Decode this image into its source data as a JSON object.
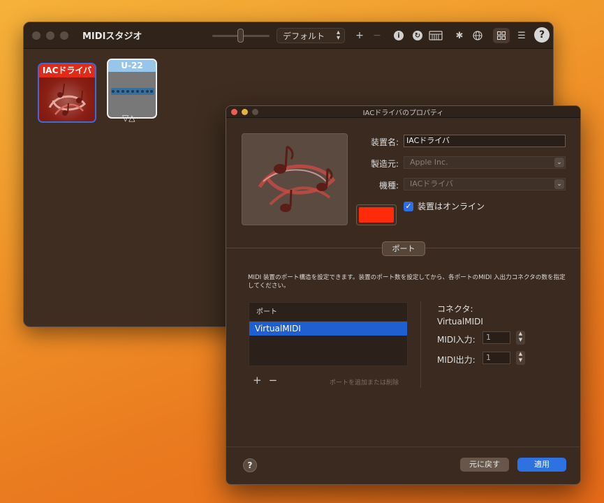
{
  "main_window": {
    "title": "MIDIスタジオ",
    "config_select": "デフォルト",
    "toolbar": {
      "add": "+",
      "remove": "−",
      "help": "?"
    },
    "devices": [
      {
        "label": "IACドライバ"
      },
      {
        "label": "U-22"
      }
    ]
  },
  "properties_window": {
    "title": "IACドライバのプロパティ",
    "fields": {
      "device_name_label": "装置名:",
      "device_name_value": "IACドライバ",
      "manufacturer_label": "製造元:",
      "manufacturer_value": "Apple Inc.",
      "model_label": "機種:",
      "model_value": "IACドライバ"
    },
    "online_checkbox": {
      "label": "装置はオンライン",
      "checked": true
    },
    "color": "#ff2a0a",
    "port_tab": "ポート",
    "description": "MIDI 装置のポート構造を設定できます。装置のポート数を設定してから、各ポートのMIDI 入出力コネクタの数を指定してください。",
    "port_table": {
      "header": "ポート",
      "rows": [
        "VirtualMIDI"
      ]
    },
    "plus": "+",
    "minus": "−",
    "add_remove_hint": "ポートを追加または削除",
    "connector": {
      "title": "コネクタ:",
      "name": "VirtualMIDI",
      "midi_in_label": "MIDI入力:",
      "midi_in_value": "1",
      "midi_out_label": "MIDI出力:",
      "midi_out_value": "1"
    },
    "help": "?",
    "revert_button": "元に戻す",
    "apply_button": "適用"
  }
}
